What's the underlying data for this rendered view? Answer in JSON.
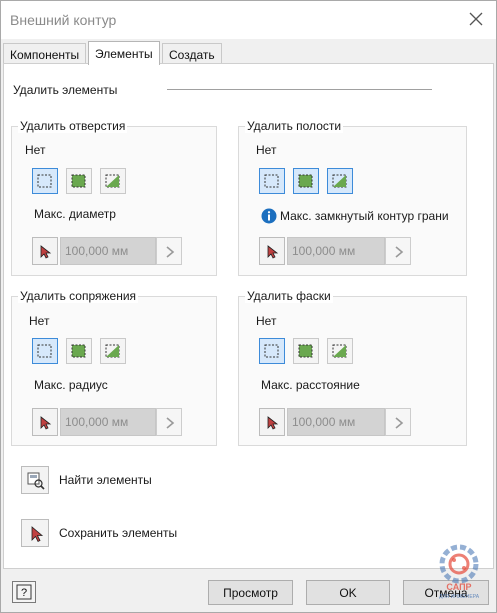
{
  "window": {
    "title": "Внешний контур"
  },
  "tabs": [
    {
      "label": "Компоненты"
    },
    {
      "label": "Элементы"
    },
    {
      "label": "Создать"
    }
  ],
  "section": {
    "title": "Удалить элементы"
  },
  "groups": {
    "holes": {
      "title": "Удалить отверстия",
      "none": "Нет",
      "param_label": "Макс. диаметр",
      "value": "100,000 мм"
    },
    "pockets": {
      "title": "Удалить полости",
      "none": "Нет",
      "param_label": "Макс. замкнутый контур грани",
      "value": "100,000 мм"
    },
    "fillets": {
      "title": "Удалить сопряжения",
      "none": "Нет",
      "param_label": "Макс. радиус",
      "value": "100,000 мм"
    },
    "chamfers": {
      "title": "Удалить фаски",
      "none": "Нет",
      "param_label": "Макс. расстояние",
      "value": "100,000 мм"
    }
  },
  "tools": {
    "find_label": "Найти элементы",
    "save_label": "Сохранить элементы"
  },
  "footer": {
    "help": "?",
    "preview": "Просмотр",
    "ok": "OK",
    "cancel": "Отмена"
  },
  "watermark": {
    "top": "САПР",
    "bottom": "ДЛЯ ИНЖЕНЕРА"
  },
  "colors": {
    "selected_border": "#3d8bd9",
    "selected_fill": "#d6e8fb",
    "feature_green": "#6aa84f",
    "info_blue": "#1c6fbf",
    "watermark_red": "#e54a3b",
    "watermark_blue": "#3e6fb0"
  },
  "icons": {
    "close": "close-icon",
    "mode_none": "dashed-square-icon",
    "mode_all": "filled-square-icon",
    "mode_partial": "half-filled-square-icon",
    "pick": "cursor-arrow-icon",
    "stepper": "chevron-right-icon",
    "info": "info-icon",
    "find": "find-features-icon"
  }
}
